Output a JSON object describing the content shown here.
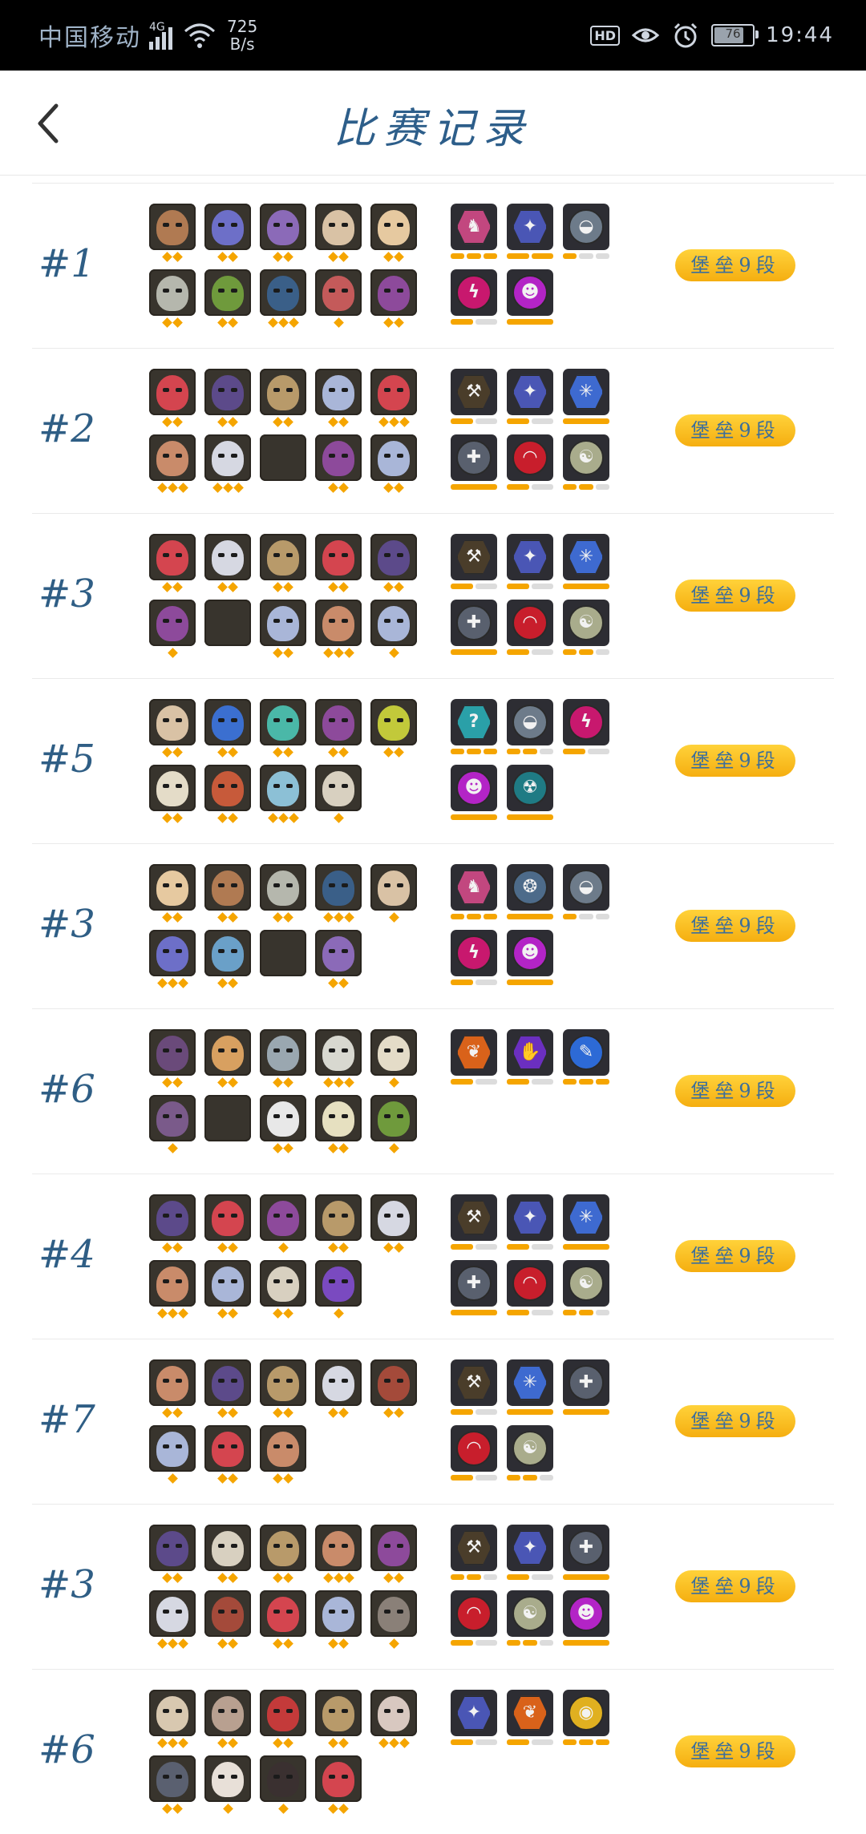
{
  "status_bar": {
    "carrier": "中国移动",
    "network": "4G",
    "speed_value": "725",
    "speed_unit": "B/s",
    "hd": "HD",
    "battery": "76",
    "time": "19:44"
  },
  "header": {
    "title": "比赛记录"
  },
  "colors": {
    "accent": "#f5a500",
    "rank_text": "#2f5e85",
    "badge_start": "#ffd23a",
    "badge_end": "#f5ae10"
  },
  "records": [
    {
      "rank": "#1",
      "badge": "堡垒9段",
      "units": [
        {
          "stars": 2,
          "color": "#b07a52"
        },
        {
          "stars": 2,
          "color": "#6d6fc8"
        },
        {
          "stars": 2,
          "color": "#8b6ab8"
        },
        {
          "stars": 2,
          "color": "#d9c2a5"
        },
        {
          "stars": 2,
          "color": "#e6c9a0"
        },
        {
          "stars": 2,
          "color": "#b5b7ad"
        },
        {
          "stars": 2,
          "color": "#6f9a3c"
        },
        {
          "stars": 3,
          "color": "#3a5f88"
        },
        {
          "stars": 1,
          "color": "#c45a5a"
        },
        {
          "stars": 2,
          "color": "#8d4a9b"
        }
      ],
      "synergies": [
        {
          "icon": "knight-icon",
          "glyph": "♞",
          "color": "#c2477f",
          "shape": "hex",
          "bars": [
            1,
            1,
            1
          ]
        },
        {
          "icon": "demon-icon",
          "glyph": "✦",
          "color": "#4a56b5",
          "shape": "hex",
          "bars": [
            1,
            1
          ]
        },
        {
          "icon": "helmet-icon",
          "glyph": "◒",
          "color": "#6d7b8a",
          "shape": "circle",
          "bars": [
            1,
            0,
            0
          ]
        },
        {
          "icon": "slash-icon",
          "glyph": "ϟ",
          "color": "#c8186e",
          "shape": "circle",
          "bars": [
            1,
            0
          ]
        },
        {
          "icon": "skull-icon",
          "glyph": "☻",
          "color": "#b324c6",
          "shape": "circle",
          "bars": [
            1
          ]
        }
      ]
    },
    {
      "rank": "#2",
      "badge": "堡垒9段",
      "units": [
        {
          "stars": 2,
          "color": "#d4454f"
        },
        {
          "stars": 2,
          "color": "#5c4a8a"
        },
        {
          "stars": 2,
          "color": "#b89a6a"
        },
        {
          "stars": 2,
          "color": "#a9b6d8"
        },
        {
          "stars": 3,
          "color": "#d4454f"
        },
        {
          "stars": 3,
          "color": "#c98b6a"
        },
        {
          "stars": 3,
          "color": "#d6d8e2"
        },
        {
          "stars": 0,
          "color": "empty"
        },
        {
          "stars": 2,
          "color": "#8d4a9b"
        },
        {
          "stars": 2,
          "color": "#a9b6d8"
        }
      ],
      "synergies": [
        {
          "icon": "axe-icon",
          "glyph": "⚒",
          "color": "#4a3d2a",
          "shape": "hex",
          "bars": [
            1,
            0
          ]
        },
        {
          "icon": "demon-icon",
          "glyph": "✦",
          "color": "#4a56b5",
          "shape": "hex",
          "bars": [
            1,
            0
          ]
        },
        {
          "icon": "ice-icon",
          "glyph": "✳",
          "color": "#3e6ad0",
          "shape": "hex",
          "bars": [
            1
          ]
        },
        {
          "icon": "cross-icon",
          "glyph": "✚",
          "color": "#59606e",
          "shape": "circle",
          "bars": [
            1
          ]
        },
        {
          "icon": "arch-icon",
          "glyph": "◠",
          "color": "#c81e2c",
          "shape": "circle",
          "bars": [
            1,
            0
          ]
        },
        {
          "icon": "mask-icon",
          "glyph": "☯",
          "color": "#a9ac8c",
          "shape": "circle",
          "bars": [
            1,
            1,
            0
          ]
        }
      ]
    },
    {
      "rank": "#3",
      "badge": "堡垒9段",
      "units": [
        {
          "stars": 2,
          "color": "#d4454f"
        },
        {
          "stars": 2,
          "color": "#d6d8e2"
        },
        {
          "stars": 2,
          "color": "#b89a6a"
        },
        {
          "stars": 2,
          "color": "#d4454f"
        },
        {
          "stars": 2,
          "color": "#5c4a8a"
        },
        {
          "stars": 1,
          "color": "#8d4a9b"
        },
        {
          "stars": 0,
          "color": "empty"
        },
        {
          "stars": 2,
          "color": "#a9b6d8"
        },
        {
          "stars": 3,
          "color": "#c98b6a"
        },
        {
          "stars": 1,
          "color": "#a9b6d8"
        }
      ],
      "synergies": [
        {
          "icon": "axe-icon",
          "glyph": "⚒",
          "color": "#4a3d2a",
          "shape": "hex",
          "bars": [
            1,
            0
          ]
        },
        {
          "icon": "demon-icon",
          "glyph": "✦",
          "color": "#4a56b5",
          "shape": "hex",
          "bars": [
            1,
            0
          ]
        },
        {
          "icon": "ice-icon",
          "glyph": "✳",
          "color": "#3e6ad0",
          "shape": "hex",
          "bars": [
            1
          ]
        },
        {
          "icon": "cross-icon",
          "glyph": "✚",
          "color": "#59606e",
          "shape": "circle",
          "bars": [
            1
          ]
        },
        {
          "icon": "arch-icon",
          "glyph": "◠",
          "color": "#c81e2c",
          "shape": "circle",
          "bars": [
            1,
            0
          ]
        },
        {
          "icon": "mask-icon",
          "glyph": "☯",
          "color": "#a9ac8c",
          "shape": "circle",
          "bars": [
            1,
            1,
            0
          ]
        }
      ]
    },
    {
      "rank": "#5",
      "badge": "堡垒9段",
      "units": [
        {
          "stars": 2,
          "color": "#d9c2a5"
        },
        {
          "stars": 2,
          "color": "#3b6fd0"
        },
        {
          "stars": 2,
          "color": "#4ab8a8"
        },
        {
          "stars": 2,
          "color": "#8d4a9b"
        },
        {
          "stars": 2,
          "color": "#c2c93a"
        },
        {
          "stars": 2,
          "color": "#e4dcc8"
        },
        {
          "stars": 2,
          "color": "#c75a3a"
        },
        {
          "stars": 3,
          "color": "#8cc0d6"
        },
        {
          "stars": 1,
          "color": "#d8d0c0"
        }
      ],
      "synergies": [
        {
          "icon": "question-icon",
          "glyph": "?",
          "color": "#2aa0a8",
          "shape": "hex",
          "bars": [
            1,
            1,
            1
          ]
        },
        {
          "icon": "helmet-icon",
          "glyph": "◒",
          "color": "#6d7b8a",
          "shape": "circle",
          "bars": [
            1,
            1,
            0
          ]
        },
        {
          "icon": "slash-icon",
          "glyph": "ϟ",
          "color": "#c8186e",
          "shape": "circle",
          "bars": [
            1,
            0
          ]
        },
        {
          "icon": "skull-icon",
          "glyph": "☻",
          "color": "#b324c6",
          "shape": "circle",
          "bars": [
            1
          ]
        },
        {
          "icon": "beast-icon",
          "glyph": "☢",
          "color": "#1f7b84",
          "shape": "circle",
          "bars": [
            1
          ]
        }
      ]
    },
    {
      "rank": "#3",
      "badge": "堡垒9段",
      "units": [
        {
          "stars": 2,
          "color": "#e6c9a0"
        },
        {
          "stars": 2,
          "color": "#b07a52"
        },
        {
          "stars": 2,
          "color": "#b5b7ad"
        },
        {
          "stars": 3,
          "color": "#3a5f88"
        },
        {
          "stars": 1,
          "color": "#d9c2a5"
        },
        {
          "stars": 3,
          "color": "#6d6fc8"
        },
        {
          "stars": 2,
          "color": "#6aa0c8"
        },
        {
          "stars": 0,
          "color": "empty"
        },
        {
          "stars": 2,
          "color": "#8b6ab8"
        }
      ],
      "synergies": [
        {
          "icon": "knight-icon",
          "glyph": "♞",
          "color": "#c2477f",
          "shape": "hex",
          "bars": [
            1,
            1,
            1
          ]
        },
        {
          "icon": "dragon-icon",
          "glyph": "❂",
          "color": "#4d6b8a",
          "shape": "circle",
          "bars": [
            1
          ]
        },
        {
          "icon": "helmet-icon",
          "glyph": "◒",
          "color": "#6d7b8a",
          "shape": "circle",
          "bars": [
            1,
            0,
            0
          ]
        },
        {
          "icon": "slash-icon",
          "glyph": "ϟ",
          "color": "#c8186e",
          "shape": "circle",
          "bars": [
            1,
            0
          ]
        },
        {
          "icon": "skull-icon",
          "glyph": "☻",
          "color": "#b324c6",
          "shape": "circle",
          "bars": [
            1
          ]
        }
      ]
    },
    {
      "rank": "#6",
      "badge": "堡垒9段",
      "units": [
        {
          "stars": 2,
          "color": "#6a4a7a"
        },
        {
          "stars": 2,
          "color": "#d8a060"
        },
        {
          "stars": 2,
          "color": "#9aa7b0"
        },
        {
          "stars": 3,
          "color": "#d8d8d0"
        },
        {
          "stars": 1,
          "color": "#e4dcc8"
        },
        {
          "stars": 1,
          "color": "#7a5a8a"
        },
        {
          "stars": 0,
          "color": "empty"
        },
        {
          "stars": 2,
          "color": "#e8e8e8"
        },
        {
          "stars": 2,
          "color": "#e6e0c0"
        },
        {
          "stars": 1,
          "color": "#6f9a3c"
        }
      ],
      "synergies": [
        {
          "icon": "leaf-icon",
          "glyph": "❦",
          "color": "#d9621a",
          "shape": "hex",
          "bars": [
            1,
            0
          ]
        },
        {
          "icon": "hand-icon",
          "glyph": "✋",
          "color": "#6b2fc0",
          "shape": "hex",
          "bars": [
            1,
            0
          ]
        },
        {
          "icon": "feather-icon",
          "glyph": "✎",
          "color": "#2d6ad6",
          "shape": "circle",
          "bars": [
            1,
            1,
            1
          ]
        }
      ]
    },
    {
      "rank": "#4",
      "badge": "堡垒9段",
      "units": [
        {
          "stars": 2,
          "color": "#5c4a8a"
        },
        {
          "stars": 2,
          "color": "#d4454f"
        },
        {
          "stars": 1,
          "color": "#8d4a9b"
        },
        {
          "stars": 2,
          "color": "#b89a6a"
        },
        {
          "stars": 2,
          "color": "#d6d8e2"
        },
        {
          "stars": 3,
          "color": "#c98b6a"
        },
        {
          "stars": 2,
          "color": "#a9b6d8"
        },
        {
          "stars": 2,
          "color": "#d8d0c0"
        },
        {
          "stars": 1,
          "color": "#7a4ac0"
        }
      ],
      "synergies": [
        {
          "icon": "axe-icon",
          "glyph": "⚒",
          "color": "#4a3d2a",
          "shape": "hex",
          "bars": [
            1,
            0
          ]
        },
        {
          "icon": "demon-icon",
          "glyph": "✦",
          "color": "#4a56b5",
          "shape": "hex",
          "bars": [
            1,
            0
          ]
        },
        {
          "icon": "ice-icon",
          "glyph": "✳",
          "color": "#3e6ad0",
          "shape": "hex",
          "bars": [
            1
          ]
        },
        {
          "icon": "cross-icon",
          "glyph": "✚",
          "color": "#59606e",
          "shape": "circle",
          "bars": [
            1
          ]
        },
        {
          "icon": "arch-icon",
          "glyph": "◠",
          "color": "#c81e2c",
          "shape": "circle",
          "bars": [
            1,
            0
          ]
        },
        {
          "icon": "mask-icon",
          "glyph": "☯",
          "color": "#a9ac8c",
          "shape": "circle",
          "bars": [
            1,
            1,
            0
          ]
        }
      ]
    },
    {
      "rank": "#7",
      "badge": "堡垒9段",
      "units": [
        {
          "stars": 2,
          "color": "#c98b6a"
        },
        {
          "stars": 2,
          "color": "#5c4a8a"
        },
        {
          "stars": 2,
          "color": "#b89a6a"
        },
        {
          "stars": 2,
          "color": "#d6d8e2"
        },
        {
          "stars": 2,
          "color": "#a44a3a"
        },
        {
          "stars": 1,
          "color": "#a9b6d8"
        },
        {
          "stars": 2,
          "color": "#d4454f"
        },
        {
          "stars": 2,
          "color": "#c98b6a"
        }
      ],
      "synergies": [
        {
          "icon": "axe-icon",
          "glyph": "⚒",
          "color": "#4a3d2a",
          "shape": "hex",
          "bars": [
            1,
            0
          ]
        },
        {
          "icon": "ice-icon",
          "glyph": "✳",
          "color": "#3e6ad0",
          "shape": "hex",
          "bars": [
            1
          ]
        },
        {
          "icon": "cross-icon",
          "glyph": "✚",
          "color": "#59606e",
          "shape": "circle",
          "bars": [
            1
          ]
        },
        {
          "icon": "arch-icon",
          "glyph": "◠",
          "color": "#c81e2c",
          "shape": "circle",
          "bars": [
            1,
            0
          ]
        },
        {
          "icon": "mask-icon",
          "glyph": "☯",
          "color": "#a9ac8c",
          "shape": "circle",
          "bars": [
            1,
            1,
            0
          ]
        }
      ]
    },
    {
      "rank": "#3",
      "badge": "堡垒9段",
      "units": [
        {
          "stars": 2,
          "color": "#5c4a8a"
        },
        {
          "stars": 2,
          "color": "#d8d0c0"
        },
        {
          "stars": 2,
          "color": "#b89a6a"
        },
        {
          "stars": 3,
          "color": "#c98b6a"
        },
        {
          "stars": 2,
          "color": "#8d4a9b"
        },
        {
          "stars": 3,
          "color": "#d6d8e2"
        },
        {
          "stars": 2,
          "color": "#a44a3a"
        },
        {
          "stars": 2,
          "color": "#d4454f"
        },
        {
          "stars": 2,
          "color": "#a9b6d8"
        },
        {
          "stars": 1,
          "color": "#8a8078"
        }
      ],
      "synergies": [
        {
          "icon": "axe-icon",
          "glyph": "⚒",
          "color": "#4a3d2a",
          "shape": "hex",
          "bars": [
            1,
            1,
            0
          ]
        },
        {
          "icon": "demon-icon",
          "glyph": "✦",
          "color": "#4a56b5",
          "shape": "hex",
          "bars": [
            1,
            0
          ]
        },
        {
          "icon": "cross-icon",
          "glyph": "✚",
          "color": "#59606e",
          "shape": "circle",
          "bars": [
            1
          ]
        },
        {
          "icon": "arch-icon",
          "glyph": "◠",
          "color": "#c81e2c",
          "shape": "circle",
          "bars": [
            1,
            0
          ]
        },
        {
          "icon": "mask-icon",
          "glyph": "☯",
          "color": "#a9ac8c",
          "shape": "circle",
          "bars": [
            1,
            1,
            0
          ]
        },
        {
          "icon": "skull-icon",
          "glyph": "☻",
          "color": "#b324c6",
          "shape": "circle",
          "bars": [
            1
          ]
        }
      ]
    },
    {
      "rank": "#6",
      "badge": "堡垒9段",
      "units": [
        {
          "stars": 3,
          "color": "#d8c8b0"
        },
        {
          "stars": 2,
          "color": "#b8a090"
        },
        {
          "stars": 2,
          "color": "#c43a3a"
        },
        {
          "stars": 2,
          "color": "#b89a6a"
        },
        {
          "stars": 3,
          "color": "#d8c8c0"
        },
        {
          "stars": 2,
          "color": "#5a6070"
        },
        {
          "stars": 1,
          "color": "#e8e0d8"
        },
        {
          "stars": 1,
          "color": "#3a3030"
        },
        {
          "stars": 2,
          "color": "#d4454f"
        }
      ],
      "synergies": [
        {
          "icon": "demon-icon",
          "glyph": "✦",
          "color": "#4a56b5",
          "shape": "hex",
          "bars": [
            1,
            0
          ]
        },
        {
          "icon": "leaf-icon",
          "glyph": "❦",
          "color": "#d9621a",
          "shape": "hex",
          "bars": [
            1,
            0
          ]
        },
        {
          "icon": "eye-icon",
          "glyph": "◉",
          "color": "#e0b020",
          "shape": "circle",
          "bars": [
            1,
            1,
            1
          ]
        }
      ]
    }
  ]
}
